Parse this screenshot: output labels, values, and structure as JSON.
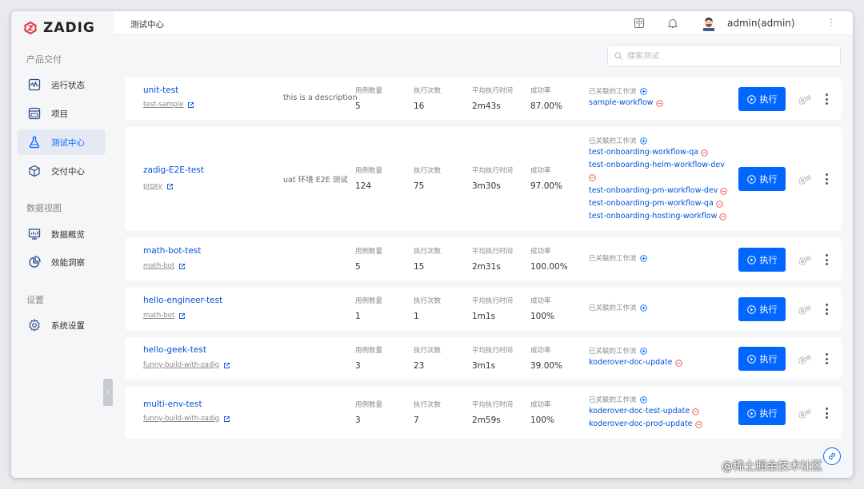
{
  "app": {
    "logo_text": "ZADIG",
    "brand_color": "#e5323e",
    "accent_color": "#0066ff"
  },
  "sidebar": {
    "sections": [
      {
        "title": "产品交付",
        "items": [
          {
            "label": "运行状态",
            "icon": "pulse-icon"
          },
          {
            "label": "项目",
            "icon": "project-icon"
          },
          {
            "label": "测试中心",
            "icon": "flask-icon",
            "active": true
          },
          {
            "label": "交付中心",
            "icon": "package-icon"
          }
        ]
      },
      {
        "title": "数据视图",
        "items": [
          {
            "label": "数据概览",
            "icon": "monitor-chart-icon"
          },
          {
            "label": "效能洞察",
            "icon": "pie-chart-icon"
          }
        ]
      },
      {
        "title": "设置",
        "items": [
          {
            "label": "系统设置",
            "icon": "gear-icon"
          }
        ]
      }
    ],
    "collapse_glyph": "‹"
  },
  "header": {
    "title": "测试中心",
    "user": "admin(admin)",
    "more_glyph": "⋮"
  },
  "search": {
    "placeholder": "搜索测试"
  },
  "labels": {
    "cases": "用例数量",
    "runs": "执行次数",
    "avg_time": "平均执行时间",
    "success": "成功率",
    "linked_workflows": "已关联的工作流",
    "run_button": "执行"
  },
  "tests": [
    {
      "name": "unit-test",
      "repo": "test-sample",
      "description": "this is a description",
      "cases": "5",
      "runs": "16",
      "avg_time": "2m43s",
      "success": "87.00%",
      "workflows": [
        "sample-workflow"
      ]
    },
    {
      "name": "zadig-E2E-test",
      "repo": "proxy",
      "description": "uat 环境 E2E 测试",
      "cases": "124",
      "runs": "75",
      "avg_time": "3m30s",
      "success": "97.00%",
      "workflows": [
        "test-onboarding-workflow-qa",
        "test-onboarding-helm-workflow-dev",
        "test-onboarding-pm-workflow-dev",
        "test-onboarding-pm-workflow-qa",
        "test-onboarding-hosting-workflow"
      ]
    },
    {
      "name": "math-bot-test",
      "repo": "math-bot",
      "description": "",
      "cases": "5",
      "runs": "15",
      "avg_time": "2m31s",
      "success": "100.00%",
      "workflows": []
    },
    {
      "name": "hello-engineer-test",
      "repo": "math-bot",
      "description": "",
      "cases": "1",
      "runs": "1",
      "avg_time": "1m1s",
      "success": "100%",
      "workflows": []
    },
    {
      "name": "hello-geek-test",
      "repo": "funny-build-with-zadig",
      "description": "",
      "cases": "3",
      "runs": "23",
      "avg_time": "3m1s",
      "success": "39.00%",
      "workflows": [
        "koderover-doc-update"
      ]
    },
    {
      "name": "multi-env-test",
      "repo": "funny-build-with-zadig",
      "description": "",
      "cases": "3",
      "runs": "7",
      "avg_time": "2m59s",
      "success": "100%",
      "workflows": [
        "koderover-doc-test-update",
        "koderover-doc-prod-update"
      ]
    }
  ],
  "watermark": "@稀土掘金技术社区"
}
